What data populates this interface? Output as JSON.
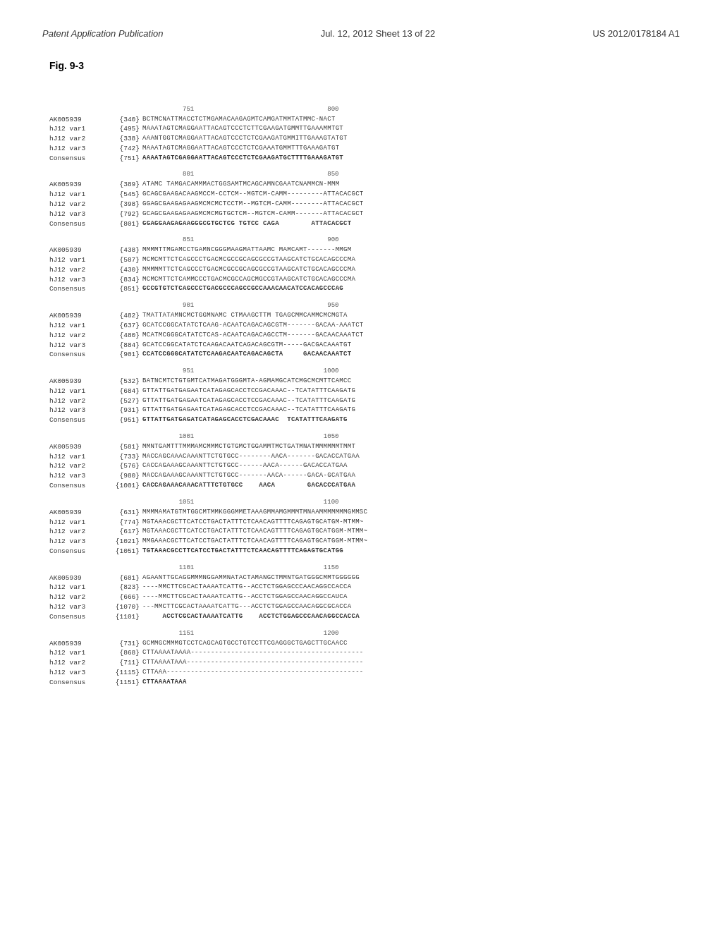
{
  "header": {
    "left": "Patent Application Publication",
    "center": "Jul. 12, 2012   Sheet 13 of 22",
    "right": "US 2012/0178184 A1"
  },
  "figure": {
    "title": "Fig. 9-3"
  },
  "blocks": [
    {
      "ruler": "                                   751                                   800",
      "lines": [
        {
          "name": "AK005939",
          "pos": "{340}",
          "seq": "BCTMCNATTMACCTCTMGAMACAAGAGMTCAMGATMMTATMMC-NACT"
        },
        {
          "name": "hJ12 var1",
          "pos": "{495}",
          "seq": "MAAATAGTCMAGGAATTACAGTCCCTCTTCGAAGATGMMTTGAAAMMTGT"
        },
        {
          "name": "hJ12 var2",
          "pos": "{338}",
          "seq": "AAANTGGTCMAGGAATTACAGTCCCTCTCGAAGATGMMITTGAAAGTATGT"
        },
        {
          "name": "hJ12 var3",
          "pos": "{742}",
          "seq": "MAAATAGTCMAGGAATTACAGTCCCTCTCGAAATGMMTTTGAAAGATGT"
        },
        {
          "name": "Consensus",
          "pos": "{751}",
          "seq": "AAAATAGTCGAGGAATTACAGTCCCTCTCGAAGATGCTTTTGAAAGATGT",
          "consensus": true
        }
      ]
    },
    {
      "ruler": "                                   801                                   850",
      "lines": [
        {
          "name": "AK005939",
          "pos": "{389}",
          "seq": "ATAMC TAMGACAMMMACTGGSAMTMCAGCAMNCGAATCNAMMCN-MMM"
        },
        {
          "name": "hJ12 var1",
          "pos": "{545}",
          "seq": "GCAGCGAAGACAAGMCCM-CCTCM--MGTCM-CAMM---------ATTACACGCT"
        },
        {
          "name": "hJ12 var2",
          "pos": "{398}",
          "seq": "GGAGCGAAGAGAAGMCMCMCTCCTM--MGTCM-CAMM--------ATTACACGCT"
        },
        {
          "name": "hJ12 var3",
          "pos": "{792}",
          "seq": "GCAGCGAAGAGAAGMCMCMGTGCTCM--MGTCM-CAMM-------ATTACACGCT"
        },
        {
          "name": "Consensus",
          "pos": "{801}",
          "seq": "GGAGGAAGAGAAGGGCGTGCTCG TGTCC CAGA        ATTACACGCT",
          "consensus": true
        }
      ]
    },
    {
      "ruler": "                                   851                                   900",
      "lines": [
        {
          "name": "AK005939",
          "pos": "{438}",
          "seq": "MMMMTTMGAMCCTGAMNCGGGMAAGMATTAAMC MAMCAMT-------MMGM"
        },
        {
          "name": "hJ12 var1",
          "pos": "{587}",
          "seq": "MCMCMTTCTCAGCCCTGACMCGCCGCAGCGCCGTAAGCATCTGCACAGCCCMA"
        },
        {
          "name": "hJ12 var2",
          "pos": "{430}",
          "seq": "MMMMMTTCTCAGCCCTGACMCGCCGCAGCGCCGTAAGCATCTGCACAGCCCMA"
        },
        {
          "name": "hJ12 var3",
          "pos": "{834}",
          "seq": "MCMCMTTCTCAMMCCCTGACMCGCCAGCMGCCGTAAGCATCTGCACAGCCCMA"
        },
        {
          "name": "Consensus",
          "pos": "{851}",
          "seq": "GCCGTGTCTCAGCCCTGACGCCCAGCCGCCAAACAACATCCACAGCCCAG",
          "consensus": true
        }
      ]
    },
    {
      "ruler": "                                   901                                   950",
      "lines": [
        {
          "name": "AK005939",
          "pos": "{482}",
          "seq": "TMATTATAMNCMCTGGMNAMC CTMAAGCTTM TGAGCMMCAMMCMCMGTA"
        },
        {
          "name": "hJ12 var1",
          "pos": "{637}",
          "seq": "GCATCCGGCATATCTCAAG-ACAATCAGACAGCGTM-------GACAA-AAATCT"
        },
        {
          "name": "hJ12 var2",
          "pos": "{480}",
          "seq": "MCATMCGGGCATATCTCAS-ACAATCAGACAGCCTM-------GACAACAAATCT"
        },
        {
          "name": "hJ12 var3",
          "pos": "{884}",
          "seq": "GCATCCGGCATATCTCAAGACAATCAGACAGCGTM-----GACGACAAATGT"
        },
        {
          "name": "Consensus",
          "pos": "{901}",
          "seq": "CCATCCGGGCATATCTCAAGACAATCAGACAGCTA     GACAACAAATCT",
          "consensus": true
        }
      ]
    },
    {
      "ruler": "                                   951                                  1000",
      "lines": [
        {
          "name": "AK005939",
          "pos": "{532}",
          "seq": "BATNCMTCTGTGMTCATMAGATGGGMTA-AGMAMGCATCMGCMCMTTCAMCC"
        },
        {
          "name": "hJ12 var1",
          "pos": "{684}",
          "seq": "GTTATTGATGAGAATCATAGAGCACCTCCGACAAAC--TCATATTTCAAGATG"
        },
        {
          "name": "hJ12 var2",
          "pos": "{527}",
          "seq": "GTTATTGATGAGAATCATAGAGCACCTCCGACAAAC--TCATATTTCAAGATG"
        },
        {
          "name": "hJ12 var3",
          "pos": "{931}",
          "seq": "GTTATTGATGAGAATCATAGAGCACCTCCGACAAAC--TCATATTTCAAGATG"
        },
        {
          "name": "Consensus",
          "pos": "{951}",
          "seq": "GTTATTGATGAGATCATAGAGCACCTCGACAAAC  TCATATTTCAAGATG",
          "consensus": true
        }
      ]
    },
    {
      "ruler": "                                  1001                                  1050",
      "lines": [
        {
          "name": "AK005939",
          "pos": "{581}",
          "seq": "MMNTGAMTTTMMMAMCMMMCTGTGMCTGGAMMTMCTGATMNATMMMMMMTMMT"
        },
        {
          "name": "hJ12 var1",
          "pos": "{733}",
          "seq": "MACCAGCAAACAAANTTCTGTGCC--------AACA-------GACACCATGAA"
        },
        {
          "name": "hJ12 var2",
          "pos": "{576}",
          "seq": "CACCAGAAAGCAAANTTCTGTGCC------AACA------GACACCATGAA"
        },
        {
          "name": "hJ12 var3",
          "pos": "{980}",
          "seq": "MACCAGAAAGCAAANTTCTGTGCC-------AACA------GACA-GCATGAA"
        },
        {
          "name": "Consensus",
          "pos": "{1001}",
          "seq": "CACCAGAAACAAACATTTCTGTGCC    AACA        GACACCCATGAA",
          "consensus": true
        }
      ]
    },
    {
      "ruler": "                                  1051                                  1100",
      "lines": [
        {
          "name": "AK005939",
          "pos": "{631}",
          "seq": "MMMMAMATGTMTGGCMTMMKGGGMMETAAAGMMAMGMMMTMNAAMMMMMMMGMMSC"
        },
        {
          "name": "hJ12 var1",
          "pos": "{774}",
          "seq": "MGTAAACGCTTCATCCTGACTATTTCTCAACAGTTTTCAGAGTGCATGM-MTMM~"
        },
        {
          "name": "hJ12 var2",
          "pos": "{617}",
          "seq": "MGTAAACGCTTCATCCTGACTATTTCTCAACAGTTTTCAGAGTGCATGGM-MTMM~"
        },
        {
          "name": "hJ12 var3",
          "pos": "{1021}",
          "seq": "MMGAAACGCTTCATCCTGACTATTTCTCAACAGTTTTCAGAGTGCATGGM-MTMM~"
        },
        {
          "name": "Consensus",
          "pos": "{1051}",
          "seq": "TGTAAACGCCTTCATCCTGACTATTTCTCAACAGTTTTCAGAGTGCATGG",
          "consensus": true
        }
      ]
    },
    {
      "ruler": "                                  1101                                  1150",
      "lines": [
        {
          "name": "AK005939",
          "pos": "{681}",
          "seq": "AGAANTTGCAGGMMMNGGAMMNATACTAMANGCTMMNTGATGGGCMMTGGGGGG"
        },
        {
          "name": "hJ12 var1",
          "pos": "{823}",
          "seq": "----MMCTTCGCACTAAAATCATTG--ACCTCTGGAGCCCAACAGGCCACCA"
        },
        {
          "name": "hJ12 var2",
          "pos": "{666}",
          "seq": "----MMCTTCGCACTAAAATCATTG--ACCTCTGGAGCCAACAGGCCAUCA"
        },
        {
          "name": "hJ12 var3",
          "pos": "{1070}",
          "seq": "---MMCTTCGCACTAAAATCATTG---ACCTCTGGAGCCAACAGGCGCACCA"
        },
        {
          "name": "Consensus",
          "pos": "{1101}",
          "seq": "     ACCTCGCACTAAAATCATTG    ACCTCTGGAGCCCAACAGGCCACCA",
          "consensus": true
        }
      ]
    },
    {
      "ruler": "                                  1151                                  1200",
      "lines": [
        {
          "name": "AK005939",
          "pos": "{731}",
          "seq": "GCMMGCMMMGTCCTCAGCAGTGCCTGTCCTTCGAGGGCTGAGCTTGCAACC"
        },
        {
          "name": "hJ12 var1",
          "pos": "{868}",
          "seq": "CTTAAAATAAAA-------------------------------------------"
        },
        {
          "name": "hJ12 var2",
          "pos": "{711}",
          "seq": "CTTAAAATAAA--------------------------------------------"
        },
        {
          "name": "hJ12 var3",
          "pos": "{1115}",
          "seq": "CTTAAA-------------------------------------------------"
        },
        {
          "name": "Consensus",
          "pos": "{1151}",
          "seq": "CTTAAAATAAA",
          "consensus": true
        }
      ]
    }
  ]
}
